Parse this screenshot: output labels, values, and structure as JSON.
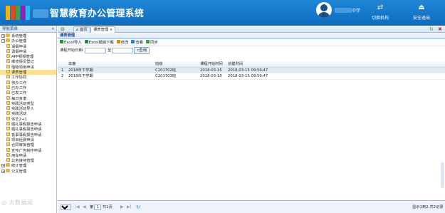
{
  "header": {
    "system_name": "智慧教育办公管理系统",
    "user_suffix": "中学",
    "switch_label": "切换机构",
    "logout_label": "安全退出",
    "colors": {
      "bar": "#1479cf"
    }
  },
  "sidebar": {
    "title": "导航菜单",
    "collapse_glyph": "«",
    "items": [
      {
        "label": "系统管理",
        "level": 0,
        "toggle": "+"
      },
      {
        "label": "办公管理",
        "level": 0,
        "toggle": "−"
      },
      {
        "label": "请假申请",
        "level": 1
      },
      {
        "label": "调假申请",
        "level": 1
      },
      {
        "label": "APP视频管理",
        "level": 1
      },
      {
        "label": "维修情况登记",
        "level": 1
      },
      {
        "label": "借物领用申请",
        "level": 1
      },
      {
        "label": "课表管理",
        "level": 1,
        "selected": true
      },
      {
        "label": "工作协同",
        "level": 1
      },
      {
        "label": "待办工作",
        "level": 1
      },
      {
        "label": "已办工作",
        "level": 1
      },
      {
        "label": "已发工作",
        "level": 1
      },
      {
        "label": "每日食谱",
        "level": 1
      },
      {
        "label": "实践活动类型",
        "level": 1
      },
      {
        "label": "实践活动导入",
        "level": 1
      },
      {
        "label": "实践活动",
        "level": 1
      },
      {
        "label": "体艺2+1",
        "level": 1
      },
      {
        "label": "婚礼事假报告申请",
        "level": 1
      },
      {
        "label": "婚礼事假报告申请",
        "level": 1
      },
      {
        "label": "丧事事假报告申请",
        "level": 1
      },
      {
        "label": "项目经费申请",
        "level": 1
      },
      {
        "label": "合同审批管理",
        "level": 1
      },
      {
        "label": "宣传广告制作申请",
        "level": 1
      },
      {
        "label": "用车申请",
        "level": 1
      },
      {
        "label": "公务接待管理",
        "level": 1
      },
      {
        "label": "统计管理",
        "level": 0,
        "toggle": "+"
      },
      {
        "label": "公文管理",
        "level": 0,
        "toggle": "+"
      }
    ]
  },
  "tabs": [
    {
      "label": "首页",
      "active": false
    },
    {
      "label": "课表管理",
      "active": true,
      "close": "×"
    }
  ],
  "panel_title": "课表管理",
  "toolbar": [
    {
      "label": "Excel导入",
      "icon": "excel-icon",
      "color": "#2e8b3a"
    },
    {
      "label": "Excel模版下载",
      "icon": "excel-icon",
      "color": "#2e8b3a"
    },
    {
      "label": "修改",
      "icon": "edit-icon",
      "color": "#d28a1e"
    },
    {
      "label": "查看",
      "icon": "view-icon",
      "color": "#3a78c9"
    },
    {
      "label": "同步",
      "icon": "sync-icon",
      "color": "#3a9a3a"
    }
  ],
  "search": {
    "label": "课程开始日期:",
    "separator": "至",
    "button": "查询",
    "from_value": "",
    "to_value": ""
  },
  "grid": {
    "columns": [
      "年度",
      "班级",
      "课程开始时间",
      "创建时间"
    ],
    "rows": [
      {
        "no": "1",
        "year": "2018年下学期",
        "class": "C201702班",
        "start": "2018-03-15",
        "created": "2018-03-15 09:59:47"
      },
      {
        "no": "2",
        "year": "2018年下学期",
        "class": "C201703班",
        "start": "2018-03-15",
        "created": "2018-03-15 09:59:47"
      }
    ]
  },
  "pager": {
    "page_size": "10",
    "page_prefix": "第",
    "page_value": "1",
    "page_suffix": "共1页",
    "summary": "显示1到2,共2记录",
    "first": "|◀",
    "prev": "◀",
    "next": "▶",
    "last": "▶|",
    "refresh": "↻"
  },
  "watermark": "大数据阅"
}
